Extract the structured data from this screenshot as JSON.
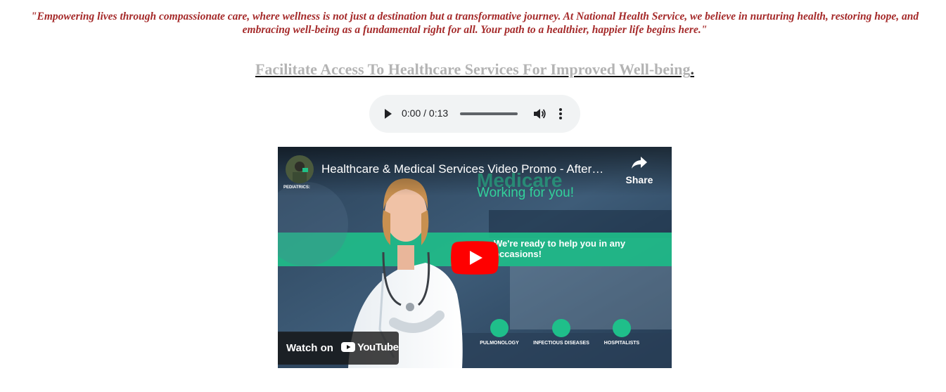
{
  "quote": "\"Empowering lives through compassionate care, where wellness is not just a destination but a transformative journey. At National Health Service, we believe in nurturing health, restoring hope, and embracing well-being as a fundamental right for all. Your path to a healthier, happier life begins here.\"",
  "heading": {
    "text": "Facilitate Access To Healthcare Services For Improved Well-being",
    "trailing": "."
  },
  "audio": {
    "time": "0:00 / 0:13",
    "progress": 0
  },
  "video": {
    "title": "Healthcare & Medical Services Video Promo - After…",
    "share_label": "Share",
    "watch_on": "Watch on",
    "youtube": "YouTube",
    "scene": {
      "medicare": "Medicare",
      "working": "Working for you!",
      "ready_line1": "We're ready to help you in any",
      "ready_line2": "occasions!",
      "pediatrics": "PEDIATRICS:",
      "categories": [
        "PULMONOLOGY",
        "INFECTIOUS DISEASES",
        "HOSPITALISTS"
      ]
    },
    "colors": {
      "teal": "#1fbf8a",
      "youtube_red": "#ff0000"
    }
  }
}
